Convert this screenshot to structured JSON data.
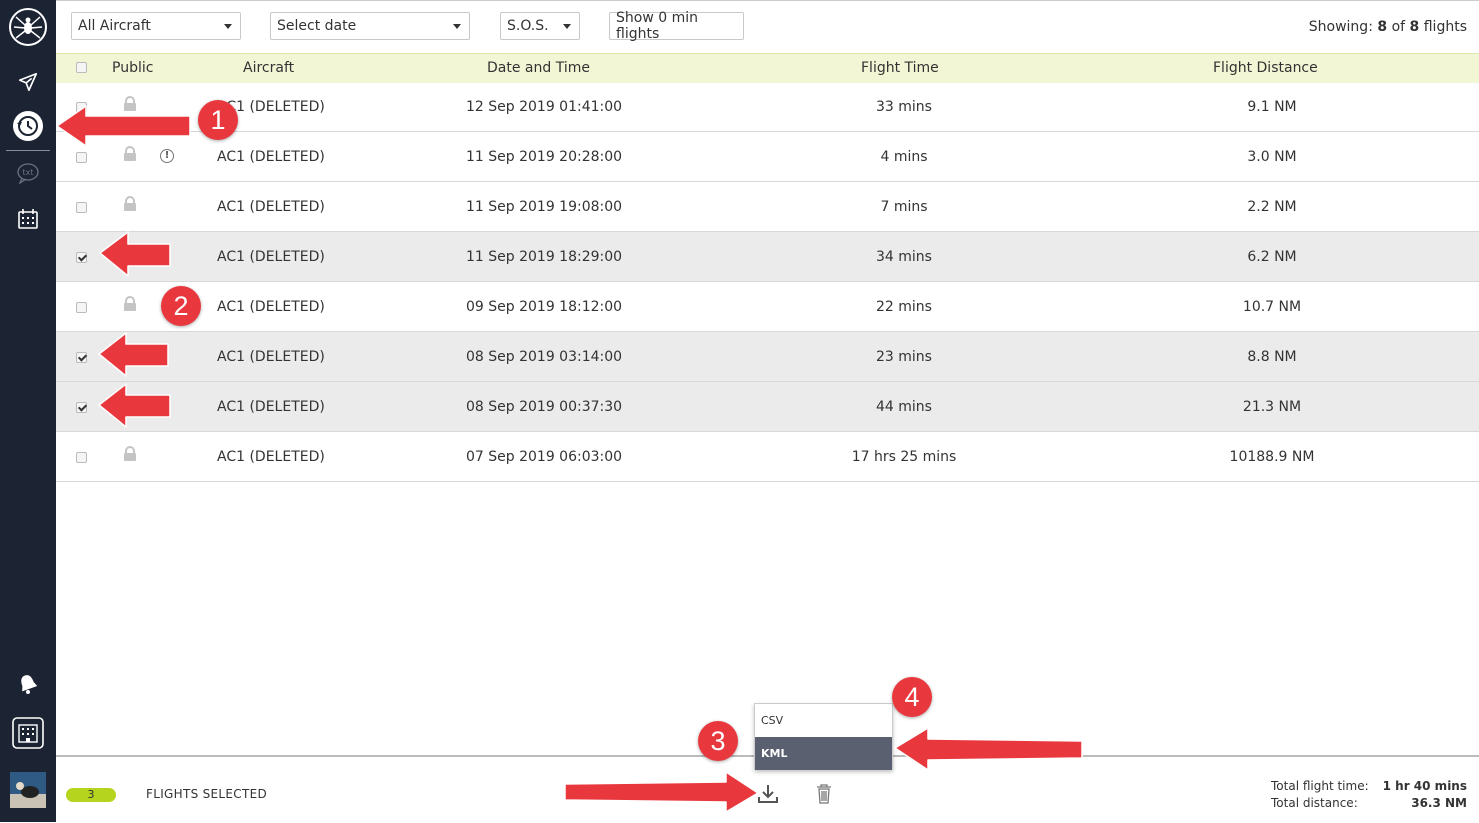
{
  "filters": {
    "aircraft": "All Aircraft",
    "date": "Select date",
    "sos": "S.O.S.",
    "show_zero": "Show 0 min flights"
  },
  "showing": {
    "prefix": "Showing:",
    "shown": "8",
    "of": "of",
    "total": "8",
    "suffix": "flights"
  },
  "columns": {
    "public": "Public",
    "aircraft": "Aircraft",
    "datetime": "Date and Time",
    "flight_time": "Flight Time",
    "distance": "Flight Distance"
  },
  "rows": [
    {
      "aircraft": "AC1 (DELETED)",
      "datetime": "12 Sep 2019 01:41:00",
      "time": "33 mins",
      "distance": "9.1 NM",
      "checked": false,
      "warning": false
    },
    {
      "aircraft": "AC1 (DELETED)",
      "datetime": "11 Sep 2019 20:28:00",
      "time": "4 mins",
      "distance": "3.0 NM",
      "checked": false,
      "warning": true
    },
    {
      "aircraft": "AC1 (DELETED)",
      "datetime": "11 Sep 2019 19:08:00",
      "time": "7 mins",
      "distance": "2.2 NM",
      "checked": false,
      "warning": false
    },
    {
      "aircraft": "AC1 (DELETED)",
      "datetime": "11 Sep 2019 18:29:00",
      "time": "34 mins",
      "distance": "6.2 NM",
      "checked": true,
      "warning": false
    },
    {
      "aircraft": "AC1 (DELETED)",
      "datetime": "09 Sep 2019 18:12:00",
      "time": "22 mins",
      "distance": "10.7 NM",
      "checked": false,
      "warning": false
    },
    {
      "aircraft": "AC1 (DELETED)",
      "datetime": "08 Sep 2019 03:14:00",
      "time": "23 mins",
      "distance": "8.8 NM",
      "checked": true,
      "warning": false
    },
    {
      "aircraft": "AC1 (DELETED)",
      "datetime": "08 Sep 2019 00:37:30",
      "time": "44 mins",
      "distance": "21.3 NM",
      "checked": true,
      "warning": false
    },
    {
      "aircraft": "AC1 (DELETED)",
      "datetime": "07 Sep 2019 06:03:00",
      "time": "17 hrs 25 mins",
      "distance": "10188.9 NM",
      "checked": false,
      "warning": false
    }
  ],
  "footer": {
    "selected_count": "3",
    "selected_label": "FLIGHTS SELECTED",
    "total_time_label": "Total flight time:",
    "total_time": "1 hr 40 mins",
    "total_distance_label": "Total distance:",
    "total_distance": "36.3 NM"
  },
  "export_menu": {
    "csv": "CSV",
    "kml": "KML"
  },
  "callouts": [
    "1",
    "2",
    "3",
    "4"
  ],
  "icons": {
    "sidebar": [
      "spider-logo-icon",
      "airplane-icon",
      "history-icon",
      "txt-chat-icon",
      "calendar-icon",
      "bell-icon",
      "building-icon",
      "avatar"
    ],
    "warning": "exclamation-icon",
    "lock": "lock-icon",
    "download": "download-icon",
    "trash": "trash-icon"
  },
  "colors": {
    "sidebar": "#1c2333",
    "header": "#f3f6d5",
    "badge": "#b5d41e",
    "callout": "#e8383d",
    "menu_highlight": "#5b6070"
  }
}
